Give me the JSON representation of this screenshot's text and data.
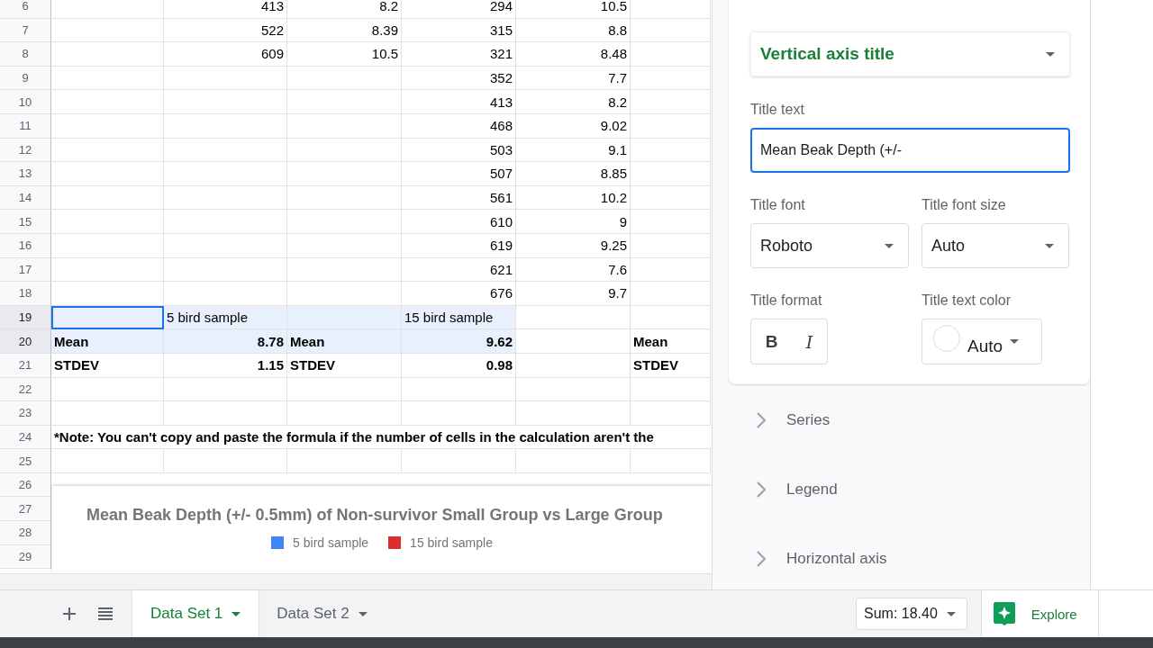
{
  "grid": {
    "rows": [
      {
        "number": "6",
        "cells": [
          {},
          {
            "text": "413",
            "kind": "number"
          },
          {
            "text": "8.2",
            "kind": "number"
          },
          {
            "text": "294",
            "kind": "number"
          },
          {
            "text": "10.5",
            "kind": "number"
          },
          {},
          {}
        ]
      },
      {
        "number": "7",
        "cells": [
          {},
          {
            "text": "522",
            "kind": "number"
          },
          {
            "text": "8.39",
            "kind": "number"
          },
          {
            "text": "315",
            "kind": "number"
          },
          {
            "text": "8.8",
            "kind": "number"
          },
          {},
          {}
        ]
      },
      {
        "number": "8",
        "cells": [
          {},
          {
            "text": "609",
            "kind": "number"
          },
          {
            "text": "10.5",
            "kind": "number"
          },
          {
            "text": "321",
            "kind": "number"
          },
          {
            "text": "8.48",
            "kind": "number"
          },
          {},
          {}
        ]
      },
      {
        "number": "9",
        "cells": [
          {},
          {},
          {},
          {
            "text": "352",
            "kind": "number"
          },
          {
            "text": "7.7",
            "kind": "number"
          },
          {},
          {}
        ]
      },
      {
        "number": "10",
        "cells": [
          {},
          {},
          {},
          {
            "text": "413",
            "kind": "number"
          },
          {
            "text": "8.2",
            "kind": "number"
          },
          {},
          {}
        ]
      },
      {
        "number": "11",
        "cells": [
          {},
          {},
          {},
          {
            "text": "468",
            "kind": "number"
          },
          {
            "text": "9.02",
            "kind": "number"
          },
          {},
          {}
        ]
      },
      {
        "number": "12",
        "cells": [
          {},
          {},
          {},
          {
            "text": "503",
            "kind": "number"
          },
          {
            "text": "9.1",
            "kind": "number"
          },
          {},
          {}
        ]
      },
      {
        "number": "13",
        "cells": [
          {},
          {},
          {},
          {
            "text": "507",
            "kind": "number"
          },
          {
            "text": "8.85",
            "kind": "number"
          },
          {},
          {}
        ]
      },
      {
        "number": "14",
        "cells": [
          {},
          {},
          {},
          {
            "text": "561",
            "kind": "number"
          },
          {
            "text": "10.2",
            "kind": "number"
          },
          {},
          {}
        ]
      },
      {
        "number": "15",
        "cells": [
          {},
          {},
          {},
          {
            "text": "610",
            "kind": "number"
          },
          {
            "text": "9",
            "kind": "number"
          },
          {},
          {}
        ]
      },
      {
        "number": "16",
        "cells": [
          {},
          {},
          {},
          {
            "text": "619",
            "kind": "number"
          },
          {
            "text": "9.25",
            "kind": "number"
          },
          {},
          {}
        ]
      },
      {
        "number": "17",
        "cells": [
          {},
          {},
          {},
          {
            "text": "621",
            "kind": "number"
          },
          {
            "text": "7.6",
            "kind": "number"
          },
          {},
          {}
        ]
      },
      {
        "number": "18",
        "cells": [
          {},
          {},
          {},
          {
            "text": "676",
            "kind": "number"
          },
          {
            "text": "9.7",
            "kind": "number"
          },
          {},
          {}
        ]
      },
      {
        "number": "19",
        "cells": [
          {
            "selected": true,
            "active": true
          },
          {
            "text": "5 bird sample",
            "kind": "label",
            "selected": true
          },
          {
            "selected": true
          },
          {
            "text": "15 bird sample",
            "kind": "label",
            "selected": true
          },
          {},
          {},
          {}
        ]
      },
      {
        "number": "20",
        "bold": true,
        "cells": [
          {
            "text": "Mean",
            "kind": "label",
            "selected": true
          },
          {
            "text": "8.78",
            "kind": "number",
            "selected": true
          },
          {
            "text": "Mean",
            "kind": "label",
            "selected": true
          },
          {
            "text": "9.62",
            "kind": "number",
            "selected": true
          },
          {},
          {
            "text": "Mean",
            "kind": "label"
          },
          {}
        ]
      },
      {
        "number": "21",
        "bold": true,
        "cells": [
          {
            "text": "STDEV",
            "kind": "label"
          },
          {
            "text": "1.15",
            "kind": "number"
          },
          {
            "text": "STDEV",
            "kind": "label"
          },
          {
            "text": "0.98",
            "kind": "number"
          },
          {},
          {
            "text": "STDEV",
            "kind": "label"
          },
          {}
        ]
      },
      {
        "number": "22",
        "cells": [
          {},
          {},
          {},
          {},
          {},
          {},
          {}
        ]
      },
      {
        "number": "23",
        "cells": [
          {},
          {},
          {},
          {},
          {},
          {},
          {}
        ]
      },
      {
        "number": "24",
        "bold": true,
        "note": "*Note:  You can't copy and paste the formula if the number of cells in the calculation aren't the"
      },
      {
        "number": "25",
        "cells": [
          {},
          {},
          {},
          {},
          {},
          {},
          {}
        ]
      },
      {
        "number": "26"
      },
      {
        "number": "27"
      },
      {
        "number": "28"
      },
      {
        "number": "29"
      }
    ]
  },
  "chart": {
    "title": "Mean Beak Depth (+/- 0.5mm) of Non-survivor Small Group vs Large Group",
    "legend": [
      {
        "label": "5 bird sample",
        "color": "#4285f4"
      },
      {
        "label": "15 bird sample",
        "color": "#db2f2f"
      }
    ]
  },
  "editor": {
    "section_dropdown": "Vertical axis title",
    "title_text": {
      "label": "Title text",
      "value": "Mean Beak Depth (+/-",
      "focused": true
    },
    "title_font": {
      "label": "Title font",
      "value": "Roboto"
    },
    "title_font_size": {
      "label": "Title font size",
      "value": "Auto"
    },
    "title_format": {
      "label": "Title format",
      "bold": {
        "text": "B",
        "on": false
      },
      "italic": {
        "text": "I",
        "on": false
      }
    },
    "title_text_color": {
      "label": "Title text color",
      "value": "Auto"
    },
    "sections": [
      {
        "label": "Series",
        "expanded": false
      },
      {
        "label": "Legend",
        "expanded": false
      },
      {
        "label": "Horizontal axis",
        "expanded": false
      }
    ]
  },
  "sheet_tabs": [
    {
      "label": "Data Set 1",
      "selected": true
    },
    {
      "label": "Data Set 2",
      "selected": false
    }
  ],
  "status": {
    "sum": "Sum: 18.40",
    "explore": "Explore"
  }
}
